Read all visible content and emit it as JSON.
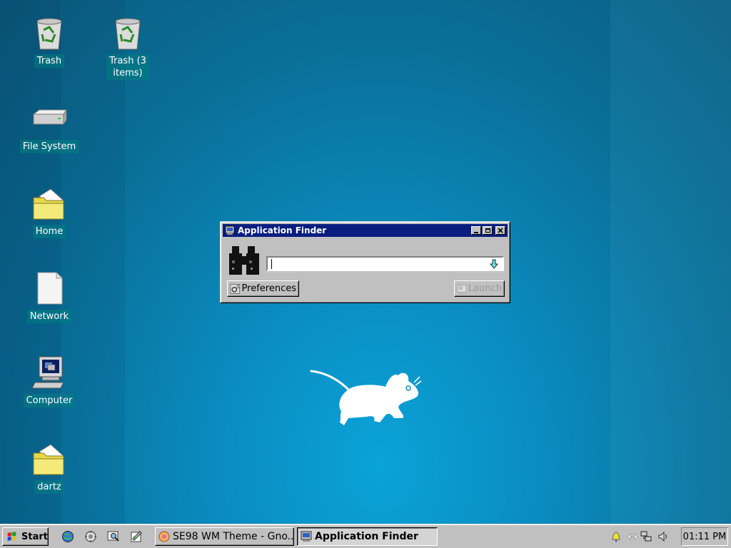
{
  "desktop": {
    "icons": [
      {
        "label": "Trash",
        "icon": "trash-icon"
      },
      {
        "label": "Trash (3 items)",
        "icon": "trash-icon"
      },
      {
        "label": "File System",
        "icon": "drive-icon"
      },
      {
        "label": "Home",
        "icon": "folder-icon"
      },
      {
        "label": "Network",
        "icon": "document-icon"
      },
      {
        "label": "Computer",
        "icon": "computer-icon"
      },
      {
        "label": "dartz",
        "icon": "folder-icon"
      }
    ]
  },
  "window": {
    "title": "Application Finder",
    "search": {
      "value": "",
      "placeholder": ""
    },
    "preferences_label": "Preferences",
    "launch_label": "Launch",
    "launch_enabled": false
  },
  "taskbar": {
    "start_label": "Start",
    "quick_launch": [
      "globe-icon",
      "settings-icon",
      "search-icon",
      "editor-icon"
    ],
    "tasks": [
      {
        "label": "SE98 WM Theme - Gno...",
        "active": false
      },
      {
        "label": "Application Finder",
        "active": true
      }
    ],
    "tray": [
      "bell-icon",
      "arrows-icon",
      "network-icon",
      "volume-icon"
    ],
    "clock": "01:11 PM"
  },
  "colors": {
    "desktop": "#0a8cc0",
    "titlebar": "#0a1e80",
    "chrome": "#c0c0c0"
  }
}
